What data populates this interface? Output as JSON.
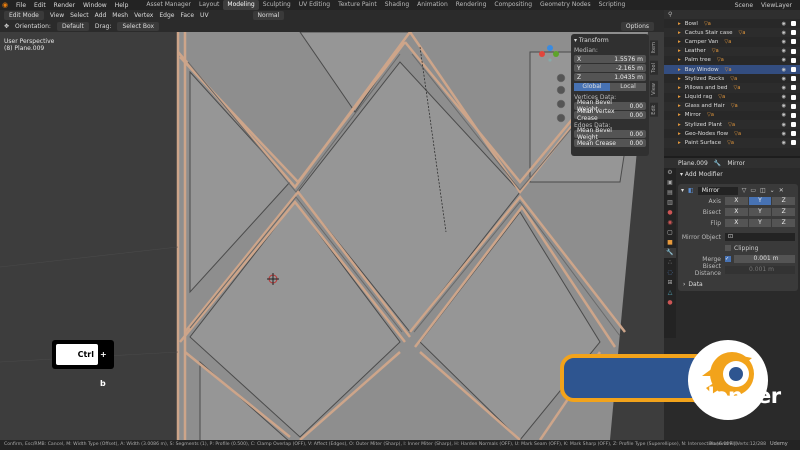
{
  "top_menu": {
    "items": [
      "File",
      "Edit",
      "Render",
      "Window",
      "Help"
    ],
    "workspaces": [
      "Asset Manager",
      "Layout",
      "Modeling",
      "Sculpting",
      "UV Editing",
      "Texture Paint",
      "Shading",
      "Animation",
      "Rendering",
      "Compositing",
      "Geometry Nodes",
      "Scripting"
    ],
    "active_workspace": "Modeling",
    "scene": "Scene",
    "view_layer": "ViewLayer"
  },
  "header": {
    "mode": "Edit Mode",
    "menus": [
      "View",
      "Select",
      "Add",
      "Mesh",
      "Vertex",
      "Edge",
      "Face",
      "UV"
    ],
    "pivot": "Normal",
    "orientation_label": "Orientation:",
    "orientation_value": "Default",
    "drag_label": "Drag:",
    "drag_value": "Select Box",
    "options": "Options"
  },
  "viewport": {
    "view_name": "User Perspective",
    "object_name": "(8) Plane.009"
  },
  "transform_panel": {
    "title": "Transform",
    "median_label": "Median:",
    "x_label": "X",
    "x_value": "1.5576 m",
    "y_label": "Y",
    "y_value": "-2.165 m",
    "z_label": "Z",
    "z_value": "1.0435 m",
    "global": "Global",
    "local": "Local",
    "vertices_data": "Vertices Data:",
    "mean_bevel_weight_label": "Mean Bevel Weight",
    "mean_bevel_weight_value": "0.00",
    "mean_vertex_crease_label": "Mean Vertex Crease",
    "mean_vertex_crease_value": "0.00",
    "edges_data": "Edges Data:",
    "edge_bevel_weight_label": "Mean Bevel Weight",
    "edge_bevel_weight_value": "0.00",
    "mean_crease_label": "Mean Crease",
    "mean_crease_value": "0.00"
  },
  "side_tabs": [
    "Item",
    "Tool",
    "View",
    "Edit"
  ],
  "outliner": {
    "items": [
      {
        "name": "Bowl",
        "selected": false
      },
      {
        "name": "Cactus Stair case",
        "selected": false
      },
      {
        "name": "Camper Van",
        "selected": false
      },
      {
        "name": "Leather",
        "selected": false
      },
      {
        "name": "Palm tree",
        "selected": false
      },
      {
        "name": "Bay Window",
        "selected": true
      },
      {
        "name": "Stylized Rocks",
        "selected": false
      },
      {
        "name": "Pillows and bed",
        "selected": false
      },
      {
        "name": "Liquid rag",
        "selected": false
      },
      {
        "name": "Glass and Hair",
        "selected": false
      },
      {
        "name": "Mirror",
        "selected": false
      },
      {
        "name": "Stylized Plant",
        "selected": false
      },
      {
        "name": "Geo-Nodes flow",
        "selected": false
      },
      {
        "name": "Paint Surface",
        "selected": false
      }
    ]
  },
  "properties": {
    "object": "Plane.009",
    "modifier_tab": "Mirror",
    "add_modifier": "Add Modifier",
    "modifier_name": "Mirror",
    "axis_label": "Axis",
    "bisect_label": "Bisect",
    "flip_label": "Flip",
    "axis_x": "X",
    "axis_y": "Y",
    "axis_z": "Z",
    "mirror_object_label": "Mirror Object",
    "clipping_label": "Clipping",
    "merge_label": "Merge",
    "merge_value": "0.001 m",
    "bisect_distance_label": "Bisect Distance",
    "bisect_distance_value": "0.001 m",
    "data_label": "Data"
  },
  "status_bar": {
    "text": "Confirm, Esc/RMB: Cancel, M: Width Type (Offset), A: Width (3.0086 m), S: Segments (1), P: Profile (0.500), C: Clamp Overlap (OFF), V: Affect (Edges), O: Outer Miter (Sharp), I: Inner Miter (Sharp), H: Harden Normals (OFF), U: Mark Seam (OFF), K: Mark Sharp (OFF), Z: Profile Type (Superellipse), N: Intersection (Grid Fill)",
    "right": "Plane.009 | Verts:12/288"
  },
  "key_overlay": {
    "key": "Ctrl",
    "plus": "+ b"
  },
  "brand": {
    "word": "blender",
    "watermark": "Udemy"
  },
  "colors": {
    "accent_blue": "#4772b3",
    "blender_orange": "#f2a31b",
    "blender_blue": "#2e5590",
    "selection_orange": "#e89a3c"
  }
}
